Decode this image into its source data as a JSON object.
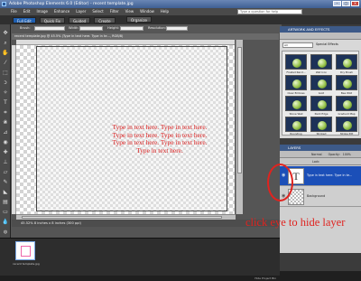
{
  "window": {
    "title": "Adobe Photoshop Elements 6.0 (Editor) - recent template.jpg"
  },
  "menu": [
    "File",
    "Edit",
    "Image",
    "Enhance",
    "Layer",
    "Select",
    "Filter",
    "View",
    "Window",
    "Help"
  ],
  "help_search": {
    "placeholder": "Type a question for help"
  },
  "modes": {
    "full": "Full Edit",
    "quick": "Quick Fix",
    "guided": "Guided",
    "create": "Create",
    "organize": "Organize"
  },
  "options": {
    "brush": "Brush:",
    "tolerance": "Tolerance",
    "width": "Width:",
    "height": "Height:",
    "resolution": "Resolution:"
  },
  "document": {
    "tab": "recent template.jpg @ 45.5% (Type in text here. Type in te..., RGB/8)",
    "status": "45.52%   8 inches x 8 inches (300 ppi)"
  },
  "canvas_text": "Type in text here. Type in text here. Type in text here. Type in text here. Type in text here. Type in text here. Type in text here.",
  "bin": {
    "caption": "recent template.jpg",
    "hide_label": "Hide Project Bin"
  },
  "panels": {
    "effects_title": "ARTWORK AND EFFECTS",
    "effects_dropdown": "All",
    "effects_section": "Special Effects",
    "effects": [
      "Frosted Rand...",
      "Wet Icon",
      "Dry Brush",
      "Clear Emboss",
      "Gold",
      "Bee Wild",
      "Stone Wall",
      "Paint Edge",
      "Gradient Map",
      "Rounding",
      "Stroked",
      "Stroke Pdt"
    ],
    "layers_title": "LAYERS",
    "blend_mode": "Normal",
    "opacity_label": "Opacity:",
    "opacity": "100%",
    "lock_label": "Lock:"
  },
  "layers": [
    {
      "name": "Type in text here. Type in te...",
      "selected": true,
      "thumb": "T"
    },
    {
      "name": "Background",
      "selected": false,
      "thumb": ""
    }
  ],
  "annotation": {
    "text": "click eye to hide layer"
  },
  "colors": {
    "annotation": "#e0231f",
    "canvas_text": "#dd2222",
    "selection": "#1b4fb8",
    "titlebar": "#4f6ea3"
  }
}
